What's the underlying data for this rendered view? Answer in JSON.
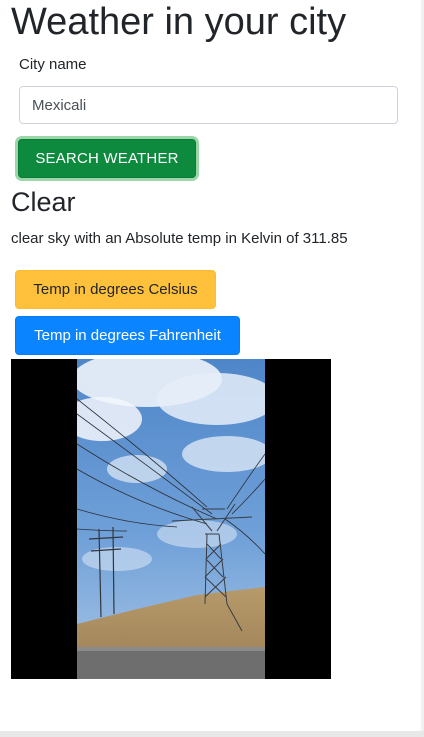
{
  "header": {
    "title": "Weather in your city"
  },
  "search": {
    "label": "City name",
    "value": "Mexicali",
    "button_label": "SEARCH WEATHER"
  },
  "result": {
    "condition": "Clear",
    "description": "clear sky with an Absolute temp in Kelvin of 311.85"
  },
  "actions": {
    "celsius_label": "Temp in degrees Celsius",
    "fahrenheit_label": "Temp in degrees Fahrenheit"
  },
  "colors": {
    "search_button": "#0e8a3e",
    "celsius_button": "#ffc13b",
    "fahrenheit_button": "#0b84ff"
  },
  "image": {
    "subject": "sky-with-power-lines-photo"
  }
}
